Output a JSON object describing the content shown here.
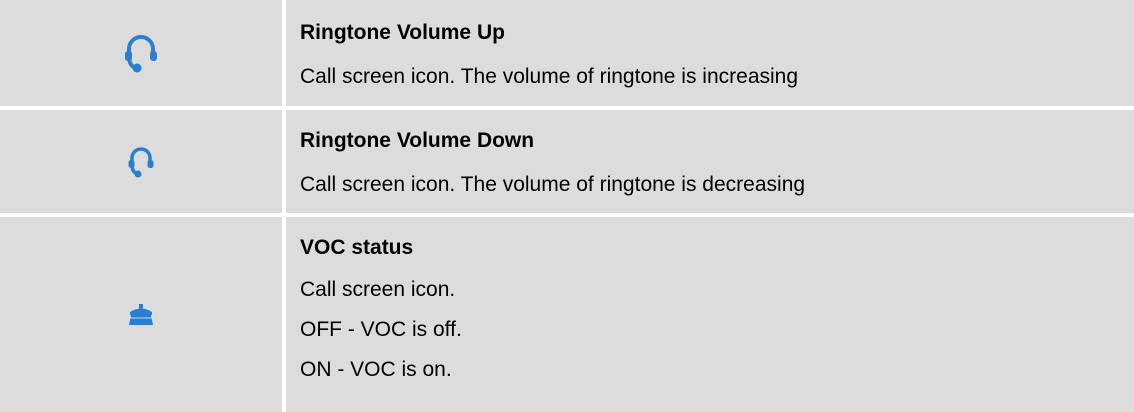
{
  "colors": {
    "row_background": "#dcdcdc",
    "icon_blue": "#2a7fd0"
  },
  "rows": [
    {
      "icon": "headset-icon",
      "title": "Ringtone Volume Up",
      "lines": [
        "Call screen icon. The volume of ringtone is increasing"
      ]
    },
    {
      "icon": "headset-icon",
      "title": "Ringtone Volume Down",
      "lines": [
        "Call screen icon. The volume of ringtone is decreasing"
      ]
    },
    {
      "icon": "phone-hangup-icon",
      "title": "VOC status",
      "lines": [
        "Call screen icon.",
        "OFF - VOC is off.",
        "ON - VOC is on."
      ]
    }
  ]
}
